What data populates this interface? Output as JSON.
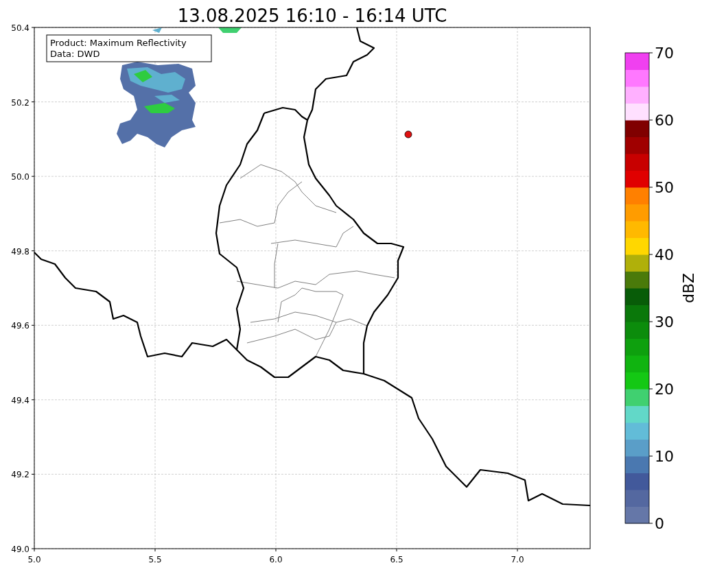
{
  "title": "13.08.2025 16:10 - 16:14 UTC",
  "info_box": {
    "lines": [
      "Product: Maximum Reflectivity",
      "Data: DWD"
    ]
  },
  "map": {
    "xticks": [
      "5.0",
      "5.5",
      "6.0",
      "6.5",
      "7.0"
    ],
    "yticks": [
      "50.4",
      "50.2",
      "50.0",
      "49.8",
      "49.6",
      "49.4",
      "49.2",
      "49.0"
    ]
  },
  "colorbar": {
    "label": "dBZ",
    "ticks": [
      "70",
      "60",
      "50",
      "40",
      "30",
      "20",
      "10",
      "0"
    ],
    "segments": [
      {
        "color": "#6577a8"
      },
      {
        "color": "#5468a0"
      },
      {
        "color": "#42599b"
      },
      {
        "color": "#4a78b0"
      },
      {
        "color": "#5a9ec8"
      },
      {
        "color": "#62bcd8"
      },
      {
        "color": "#62d8c8"
      },
      {
        "color": "#40d070"
      },
      {
        "color": "#14c814"
      },
      {
        "color": "#10b410"
      },
      {
        "color": "#0ea00e"
      },
      {
        "color": "#0c8c0c"
      },
      {
        "color": "#0a780a"
      },
      {
        "color": "#085c08"
      },
      {
        "color": "#4a7a0a"
      },
      {
        "color": "#b0b00a"
      },
      {
        "color": "#ffd700"
      },
      {
        "color": "#ffb900"
      },
      {
        "color": "#ff9c00"
      },
      {
        "color": "#ff8000"
      },
      {
        "color": "#e00000"
      },
      {
        "color": "#c80000"
      },
      {
        "color": "#a00000"
      },
      {
        "color": "#800000"
      },
      {
        "color": "#ffe0ff"
      },
      {
        "color": "#ffb0ff"
      },
      {
        "color": "#ff78ff"
      },
      {
        "color": "#f040f0"
      }
    ]
  }
}
